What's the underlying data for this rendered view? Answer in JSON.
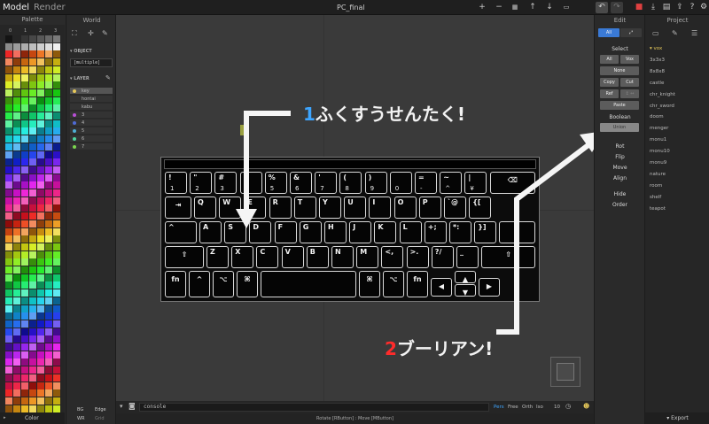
{
  "topbar": {
    "mode_model": "Model",
    "mode_render": "Render",
    "title": "PC_final"
  },
  "palette": {
    "header": "Palette",
    "tabs": [
      "0",
      "1",
      "2",
      "3"
    ],
    "footer": "Color"
  },
  "world": {
    "header": "World",
    "object_label": "OBJECT",
    "object_value": "[multiple]",
    "layer_label": "LAYER",
    "layers": [
      {
        "name": "key",
        "color": "#e6c85a"
      },
      {
        "name": "hontai",
        "color": ""
      },
      {
        "name": "kabu",
        "color": ""
      },
      {
        "name": "3",
        "color": "#b84fd6"
      },
      {
        "name": "4",
        "color": "#4f6bd6"
      },
      {
        "name": "5",
        "color": "#4fb0d6"
      },
      {
        "name": "6",
        "color": "#4fd6a0"
      },
      {
        "name": "7",
        "color": "#7bd64f"
      }
    ],
    "footer": {
      "bg": "BG",
      "edge": "Edge",
      "wr": "WR",
      "grid": "Grid"
    }
  },
  "viewport": {
    "annotation1_num": "1",
    "annotation1_text": "ふくすうせんたく!",
    "annotation2_num": "2",
    "annotation2_text": "ブーリアン!",
    "console_placeholder": "console",
    "modes": [
      "Pers",
      "Free",
      "Orth",
      "Iso"
    ],
    "zoom": "10",
    "status": "Rotate [RButton] : Move [MButton]"
  },
  "keyboard": {
    "row1": [
      [
        "!",
        "1"
      ],
      [
        "\"",
        "2"
      ],
      [
        "#",
        "3"
      ],
      [
        "$",
        "4"
      ],
      [
        "%",
        "5"
      ],
      [
        "&",
        "6"
      ],
      [
        "'",
        "7"
      ],
      [
        "(",
        "8"
      ],
      [
        ")",
        "9"
      ],
      [
        "",
        "0"
      ],
      [
        "=",
        "-"
      ],
      [
        "~",
        "^"
      ],
      [
        "|",
        "¥"
      ]
    ],
    "row2": [
      "Q",
      "W",
      "E",
      "R",
      "T",
      "Y",
      "U",
      "I",
      "O",
      "P",
      "`@",
      "{["
    ],
    "row3": [
      "A",
      "S",
      "D",
      "F",
      "G",
      "H",
      "J",
      "K",
      "L",
      "+;",
      "*:",
      "}]"
    ],
    "row4": [
      "Z",
      "X",
      "C",
      "V",
      "B",
      "N",
      "M",
      "<,",
      ">.",
      "?/",
      "_"
    ]
  },
  "edit": {
    "header": "Edit",
    "tab_all": "All",
    "select_label": "Select",
    "btn_all": "All",
    "btn_vox": "Vox",
    "btn_none": "None",
    "btn_copy": "Copy",
    "btn_cut": "Cut",
    "btn_ref": "Ref",
    "btn_paste": "Paste",
    "boolean_label": "Boolean",
    "btn_union": "Union",
    "rot": "Rot",
    "flip": "Flip",
    "move": "Move",
    "align": "Align",
    "hide": "Hide",
    "order": "Order"
  },
  "project": {
    "header": "Project",
    "items": [
      "vox",
      "3x3x3",
      "8x8x8",
      "castle",
      "chr_knight",
      "chr_sword",
      "doom",
      "menger",
      "monu1",
      "monu10",
      "monu9",
      "nature",
      "room",
      "shelf",
      "teapot"
    ],
    "footer": "Export"
  },
  "colors": {
    "accent": "#3a7ad6",
    "selected_button": "#888888"
  }
}
